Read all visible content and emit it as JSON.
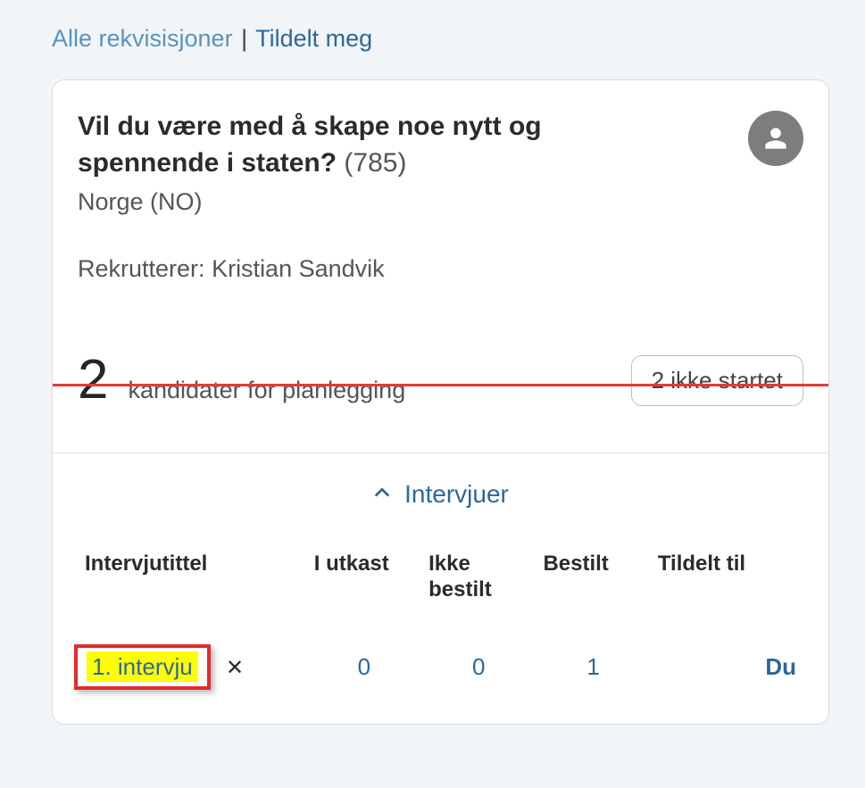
{
  "breadcrumb": {
    "all": "Alle rekvisisjoner",
    "sep": "|",
    "active": "Tildelt meg"
  },
  "req": {
    "title": "Vil du være med å skape noe nytt og spennende i staten?",
    "id": "(785)",
    "location": "Norge (NO)",
    "recruiter_label": "Rekrutterer:",
    "recruiter_name": "Kristian Sandvik"
  },
  "plan": {
    "count": "2",
    "text": "kandidater for planlegging",
    "badge": "2 ikke startet"
  },
  "section": {
    "label": "Intervjuer"
  },
  "table": {
    "headers": {
      "title": "Intervjutittel",
      "draft": "I utkast",
      "notordered": "Ikke bestilt",
      "ordered": "Bestilt",
      "assigned": "Tildelt til"
    },
    "row": {
      "title": "1. intervju",
      "draft": "0",
      "notordered": "0",
      "ordered": "1",
      "assigned": "Du"
    }
  }
}
